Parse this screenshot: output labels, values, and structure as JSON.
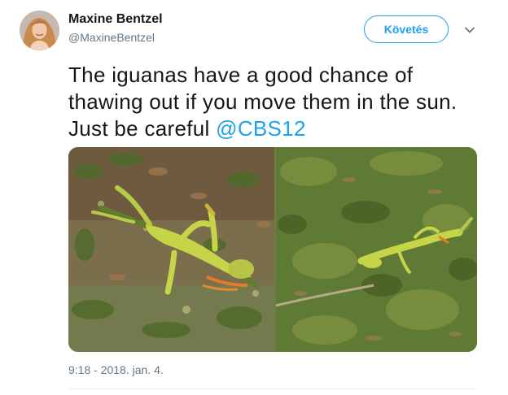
{
  "author": {
    "name": "Maxine Bentzel",
    "handle": "@MaxineBentzel"
  },
  "follow_button": {
    "label": "Követés"
  },
  "tweet": {
    "text_line1": "The iguanas have a good chance of",
    "text_line2": "thawing out if you move them in the sun.",
    "text_line3_prefix": "Just be careful ",
    "mention": "@CBS12"
  },
  "timestamp": "9:18 - 2018. jan. 4.",
  "colors": {
    "accent": "#1da1f2",
    "text": "#14171a",
    "secondary_text": "#657786"
  },
  "icons": {
    "menu": "chevron-down-icon"
  }
}
